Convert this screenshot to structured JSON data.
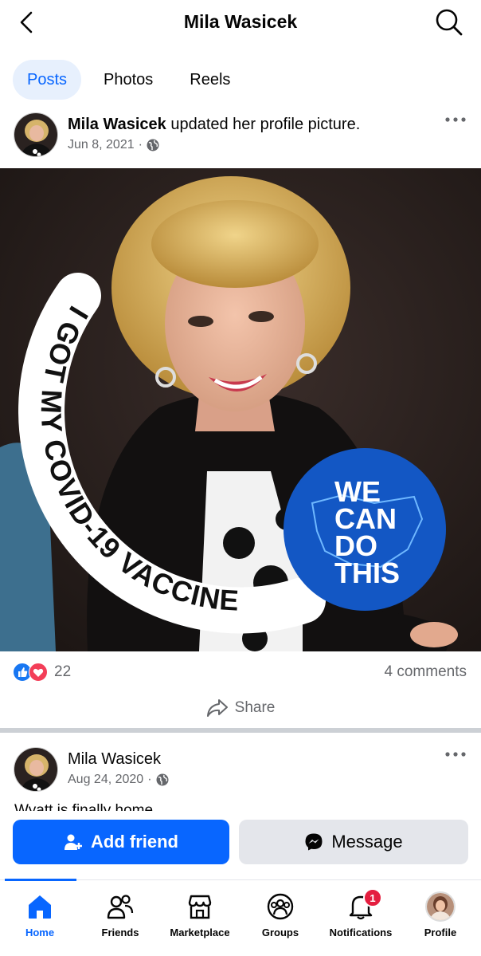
{
  "header": {
    "title": "Mila Wasicek",
    "back_icon": "chevron-left-icon",
    "search_icon": "search-icon"
  },
  "tabs": [
    {
      "label": "Posts",
      "active": true
    },
    {
      "label": "Photos",
      "active": false
    },
    {
      "label": "Reels",
      "active": false
    }
  ],
  "post1": {
    "author": "Mila Wasicek",
    "action": " updated her profile picture.",
    "date": "Jun 8, 2021",
    "dot": "·",
    "privacy_icon": "globe-icon",
    "image": {
      "frame_text": "I GOT MY COVID-19 VACCINE",
      "badge_line1": "WE",
      "badge_line2": "CAN",
      "badge_line3": "DO",
      "badge_line4": "THIS"
    },
    "reaction_count": "22",
    "comments": "4 comments",
    "share_label": "Share"
  },
  "post2": {
    "author": "Mila Wasicek",
    "date": "Aug 24, 2020",
    "dot": "·",
    "text": "Wyatt is finally home"
  },
  "actions": {
    "add_friend": "Add friend",
    "message": "Message"
  },
  "nav": [
    {
      "label": "Home",
      "icon": "home-icon",
      "active": true
    },
    {
      "label": "Friends",
      "icon": "friends-icon",
      "active": false
    },
    {
      "label": "Marketplace",
      "icon": "marketplace-icon",
      "active": false
    },
    {
      "label": "Groups",
      "icon": "groups-icon",
      "active": false
    },
    {
      "label": "Notifications",
      "icon": "bell-icon",
      "active": false,
      "badge": "1"
    },
    {
      "label": "Profile",
      "icon": "profile-avatar",
      "active": false
    }
  ],
  "colors": {
    "accent": "#0866ff",
    "badge_red": "#e41e3f",
    "secondary_bg": "#e4e6eb",
    "muted_text": "#65676b"
  }
}
